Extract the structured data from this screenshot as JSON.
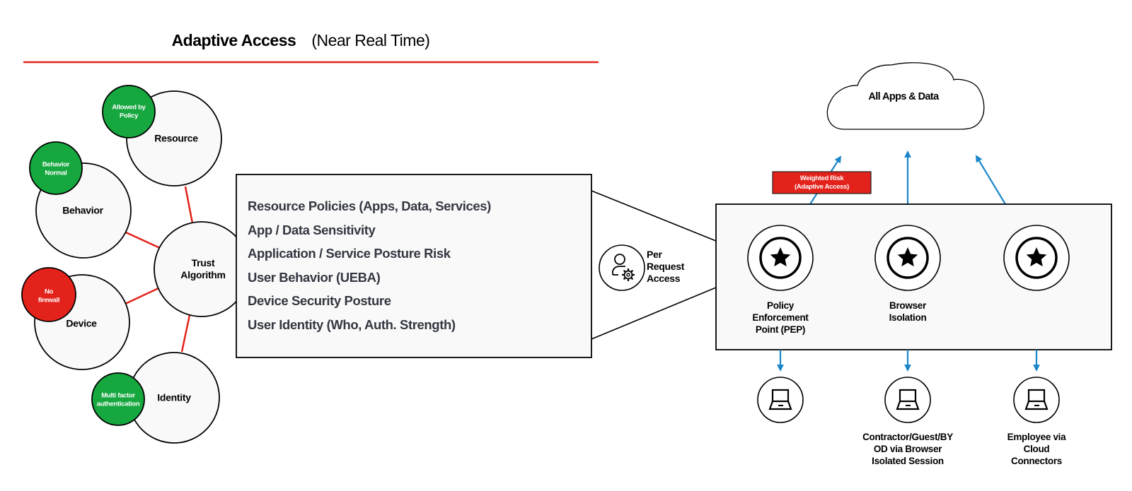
{
  "header": {
    "title": "Adaptive Access",
    "subtitle": "(Near Real Time)"
  },
  "colors": {
    "accent_red": "#e3221b",
    "status_green": "#16a73f",
    "status_red": "#e3221b",
    "arrow_blue": "#1a86c8",
    "circle_fill": "#f9f9f9",
    "text_dark": "#333740"
  },
  "trust_model": {
    "center": {
      "label_line1": "Trust",
      "label_line2": "Algorithm"
    },
    "signals": [
      {
        "name": "Resource",
        "status": "Allowed by Policy",
        "status_line1": "Allowed by",
        "status_line2": "Policy",
        "status_color": "green"
      },
      {
        "name": "Behavior",
        "status": "Behavior Normal",
        "status_line1": "Behavior",
        "status_line2": "Normal",
        "status_color": "green"
      },
      {
        "name": "Device",
        "status": "No firewall",
        "status_line1": "No",
        "status_line2": "firewall",
        "status_color": "red"
      },
      {
        "name": "Identity",
        "status": "Multi factor authentication",
        "status_line1": "Multi factor",
        "status_line2": "authentication",
        "status_color": "green"
      }
    ]
  },
  "factors": [
    "Resource Policies (Apps, Data, Services)",
    "App / Data Sensitivity",
    "Application / Service Posture Risk",
    "User Behavior (UEBA)",
    "Device Security Posture",
    "User Identity (Who, Auth. Strength)"
  ],
  "per_request": {
    "icon": "user-gear-icon",
    "line1": "Per",
    "line2": "Request",
    "line3": "Access"
  },
  "cloud": {
    "label": "All Apps & Data",
    "icon": "cloud-icon"
  },
  "risk_tag": {
    "line1": "Weighted Risk",
    "line2": "(Adaptive Access)"
  },
  "enforcement_nodes": [
    {
      "icon": "star-icon",
      "label_lines": [
        "Policy",
        "Enforcement",
        "Point (PEP)"
      ]
    },
    {
      "icon": "star-icon",
      "label_lines": [
        "Browser",
        "Isolation"
      ]
    },
    {
      "icon": "star-icon",
      "label_lines": []
    }
  ],
  "endpoints": [
    {
      "icon": "laptop-icon",
      "label_lines": []
    },
    {
      "icon": "laptop-icon",
      "label_lines": [
        "Contractor/Guest/BY",
        "OD via Browser",
        "Isolated Session"
      ]
    },
    {
      "icon": "laptop-icon",
      "label_lines": [
        "Employee via",
        "Cloud",
        "Connectors"
      ]
    }
  ]
}
